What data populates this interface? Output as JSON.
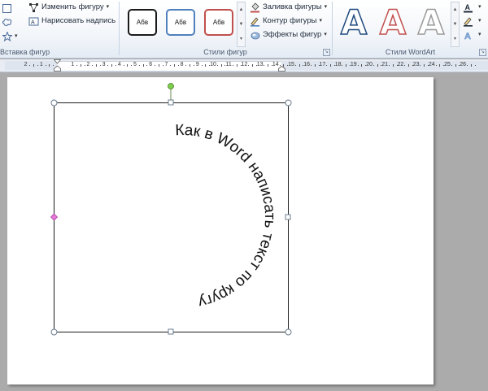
{
  "ribbon": {
    "insert_shapes": {
      "label": "Вставка фигур",
      "edit_shape": "Изменить фигуру",
      "draw_textbox": "Нарисовать надпись"
    },
    "shape_styles": {
      "label": "Стили фигур",
      "swatches": [
        {
          "text": "Абв",
          "border": "#1a1a1a"
        },
        {
          "text": "Абв",
          "border": "#4f81bd"
        },
        {
          "text": "Абв",
          "border": "#c0504d"
        }
      ],
      "fill": "Заливка фигуры",
      "outline": "Контур фигуры",
      "effects": "Эффекты фигур"
    },
    "wordart_styles": {
      "label": "Стили WordArt",
      "letters": [
        {
          "text": "A",
          "stroke": "#1f497d"
        },
        {
          "text": "A",
          "stroke": "#c0504d"
        },
        {
          "text": "A",
          "stroke": "#9a9a9a"
        }
      ]
    }
  },
  "ruler": {
    "numbers": [
      "2",
      "1",
      "1",
      "2",
      "3",
      "4",
      "5",
      "6",
      "7",
      "8",
      "9",
      "10",
      "11",
      "12",
      "13",
      "14",
      "15",
      "16",
      "17",
      "18",
      "19",
      "20",
      "21",
      "22",
      "23",
      "24",
      "25",
      "26"
    ]
  },
  "document": {
    "wordart_text": "Как в Word написать текст по кругу"
  }
}
